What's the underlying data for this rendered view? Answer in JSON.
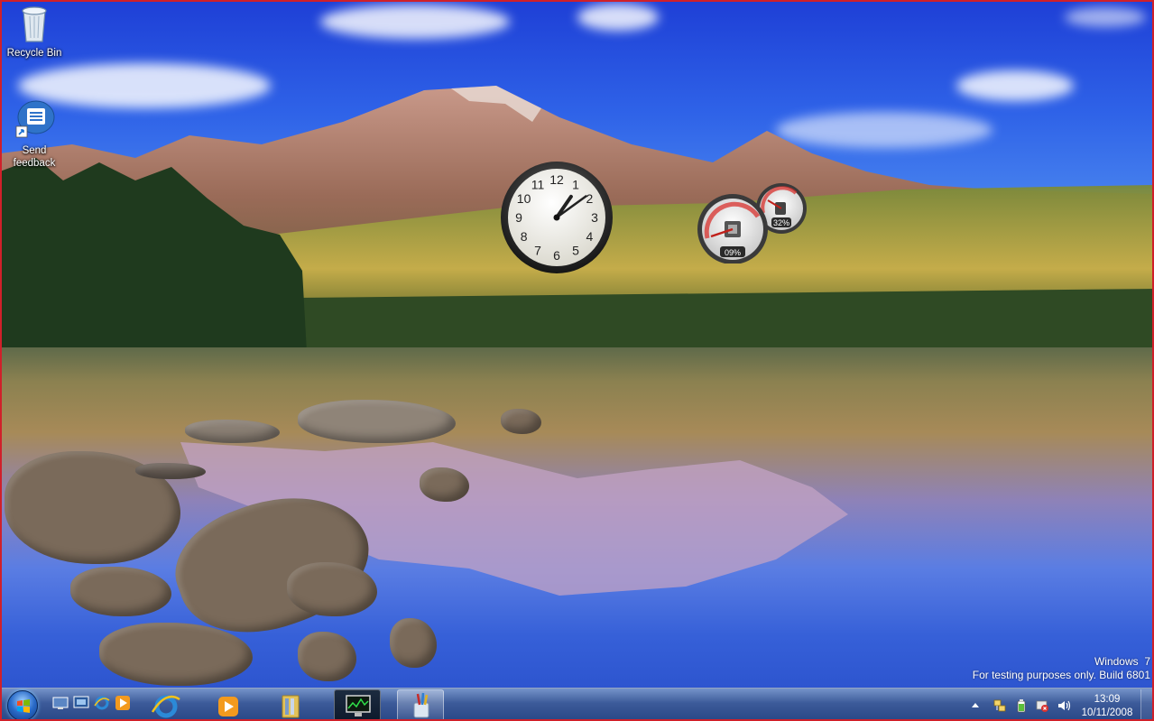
{
  "desktop": {
    "icons": [
      {
        "label": "Recycle Bin",
        "icon": "recycle-bin-icon"
      },
      {
        "label": "Send\nfeedback",
        "icon": "send-feedback-icon"
      }
    ]
  },
  "gadgets": {
    "clock": {
      "hour": 13,
      "minute": 9,
      "numerals": [
        "12",
        "1",
        "2",
        "3",
        "4",
        "5",
        "6",
        "7",
        "8",
        "9",
        "10",
        "11"
      ]
    },
    "cpu_meter": {
      "cpu_percent": "09%",
      "memory_percent": "32%"
    }
  },
  "watermark": {
    "line1": "Windows  7",
    "line2": "For testing purposes only. Build 6801"
  },
  "taskbar": {
    "quick_launch": [
      "show-desktop-icon",
      "switch-windows-icon",
      "internet-explorer-icon",
      "media-player-icon"
    ],
    "pinned": [
      "internet-explorer-icon",
      "media-player-icon",
      "windows-explorer-icon",
      "task-manager-icon",
      "paint-icon"
    ],
    "tray": [
      "show-hidden-icons-chevron-icon",
      "network-icon",
      "power-icon",
      "action-center-icon",
      "volume-icon"
    ],
    "clock_time": "13:09",
    "clock_date": "10/11/2008"
  },
  "colors": {
    "taskbar": "#3c5a96",
    "frame": "#d0202a",
    "cpu_accent": "#d8312e"
  }
}
